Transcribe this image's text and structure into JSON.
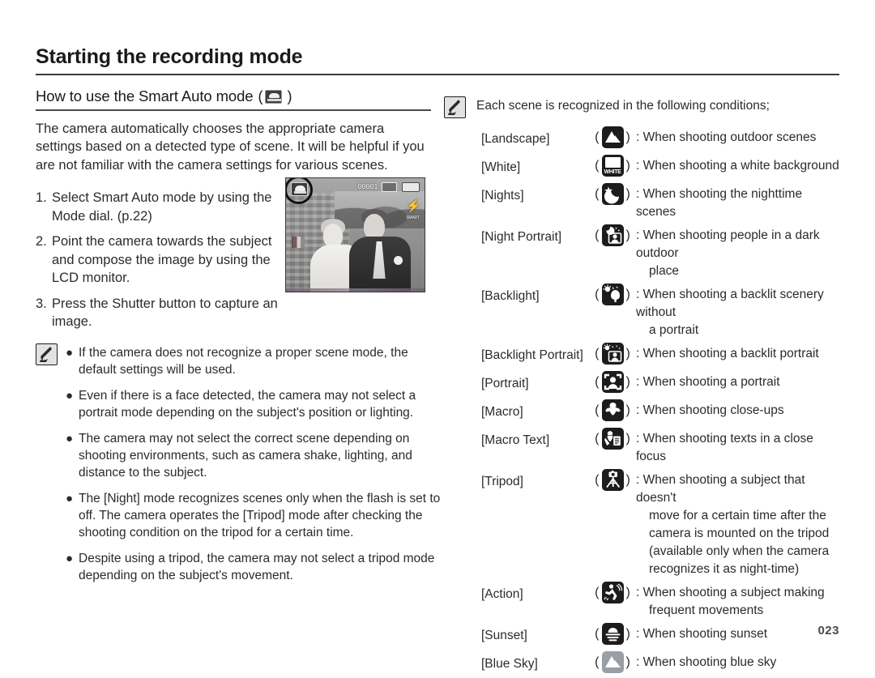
{
  "page": {
    "title": "Starting the recording mode",
    "number": "023"
  },
  "left": {
    "section_heading": "How to use the Smart Auto mode",
    "section_heading_icon": "smart-auto-mode-icon",
    "paren_open": "(",
    "paren_close": ")",
    "intro": "The camera automatically chooses the appropriate camera settings based on a detected type of scene. It will be helpful if you are not familiar with the camera settings for various scenes.",
    "steps": [
      {
        "num": "1.",
        "text": "Select Smart Auto mode by using the Mode dial. (p.22)"
      },
      {
        "num": "2.",
        "text": "Point the camera towards the subject and compose the image by using the LCD monitor."
      },
      {
        "num": "3.",
        "text": "Press the Shutter button to capture an image."
      }
    ],
    "lcd": {
      "counter": "00001",
      "mode_badge": "smart-auto-badge",
      "card_icon": "memory-card-icon",
      "battery_icon": "battery-icon",
      "flash_icon": "flash-smart-icon",
      "flash_label": "SMART",
      "meter_icon": "exposure-meter-icon"
    },
    "note_icon": "memo-note-icon",
    "notes": [
      "If the camera does not recognize a proper scene mode, the default settings will be used.",
      "Even if there is a face detected, the camera may not select a portrait mode depending on the subject's position or lighting.",
      "The camera may not select the correct scene depending on shooting environments, such as camera shake, lighting, and distance to the subject.",
      "The [Night] mode recognizes scenes only when the flash is set to off. The camera operates the [Tripod] mode after checking the shooting condition on the tripod for a certain time.",
      "Despite using a tripod, the camera may not select a tripod mode depending on the subject's movement."
    ],
    "bullet_char": "●"
  },
  "right": {
    "note_icon": "memo-note-icon",
    "heading": "Each scene is recognized in the following conditions;",
    "paren_open": "(",
    "paren_close": ")",
    "colon": ":",
    "scenes": [
      {
        "label": "[Landscape]",
        "icon": "landscape-icon",
        "desc": "When shooting outdoor scenes",
        "cont": ""
      },
      {
        "label": "[White]",
        "icon": "white-balance-icon",
        "desc": "When shooting a white background",
        "cont": ""
      },
      {
        "label": "[Nights]",
        "icon": "night-icon",
        "desc": "When shooting the nighttime scenes",
        "cont": ""
      },
      {
        "label": "[Night Portrait]",
        "icon": "night-portrait-icon",
        "desc": "When shooting people in a dark outdoor",
        "cont": "place"
      },
      {
        "label": "[Backlight]",
        "icon": "backlight-icon",
        "desc": "When shooting a backlit scenery without",
        "cont": "a portrait"
      },
      {
        "label": "[Backlight Portrait]",
        "icon": "backlight-portrait-icon",
        "desc": "When shooting a backlit portrait",
        "cont": ""
      },
      {
        "label": "[Portrait]",
        "icon": "portrait-icon",
        "desc": "When shooting a portrait",
        "cont": ""
      },
      {
        "label": "[Macro]",
        "icon": "macro-icon",
        "desc": "When shooting close-ups",
        "cont": ""
      },
      {
        "label": "[Macro Text]",
        "icon": "macro-text-icon",
        "desc": "When shooting texts in a close focus",
        "cont": ""
      },
      {
        "label": "[Tripod]",
        "icon": "tripod-icon",
        "desc": "When shooting a subject that doesn't",
        "cont": "move for a certain time after the camera is mounted on the tripod (available only when the camera recognizes it as night-time)"
      },
      {
        "label": "[Action]",
        "icon": "action-icon",
        "desc": "When shooting a subject making",
        "cont": "frequent movements"
      },
      {
        "label": "[Sunset]",
        "icon": "sunset-icon",
        "desc": "When shooting sunset",
        "cont": ""
      },
      {
        "label": "[Blue Sky]",
        "icon": "blue-sky-icon",
        "desc": "When shooting blue sky",
        "cont": ""
      }
    ],
    "white_icon_label": "WHITE"
  },
  "colors": {
    "text": "#231f20",
    "rule": "#3a3a3a",
    "icon_dark": "#1c1c1c",
    "icon_light": "#9a9fa6"
  }
}
